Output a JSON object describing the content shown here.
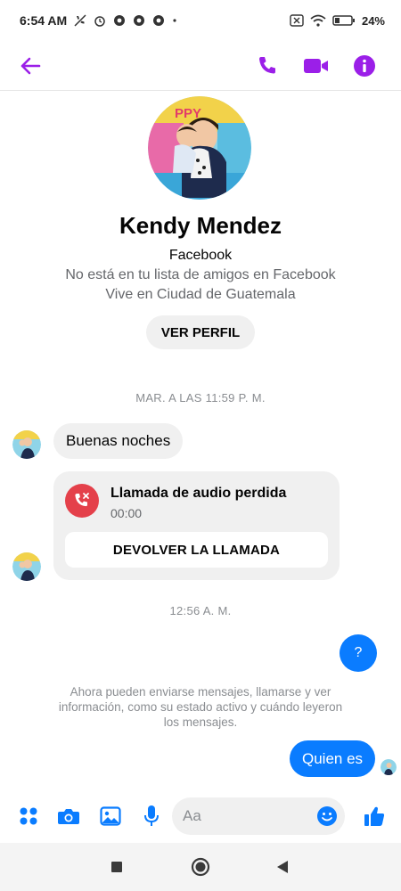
{
  "status_bar": {
    "time": "6:54 AM",
    "battery": "24%"
  },
  "profile": {
    "name": "Kendy Mendez",
    "source": "Facebook",
    "friend_status": "No está en tu lista de amigos en Facebook",
    "location": "Vive en Ciudad de Guatemala",
    "view_profile_label": "VER PERFIL"
  },
  "messages": {
    "timestamp_1": "MAR. A LAS 11:59 P. M.",
    "incoming_text": "Buenas noches",
    "missed_call_title": "Llamada de audio perdida",
    "missed_call_duration": "00:00",
    "callback_label": "DEVOLVER LA LLAMADA",
    "timestamp_2": "12:56 A. M.",
    "outgoing_question": "?",
    "info_note": "Ahora pueden enviarse mensajes, llamarse y ver información, como su estado activo y cuándo leyeron los mensajes.",
    "outgoing_text": "Quien es"
  },
  "composer": {
    "placeholder": "Aa"
  },
  "colors": {
    "accent_purple": "#9b1fe8",
    "messenger_blue": "#0a7cff",
    "missed_call_red": "#e4404a"
  }
}
